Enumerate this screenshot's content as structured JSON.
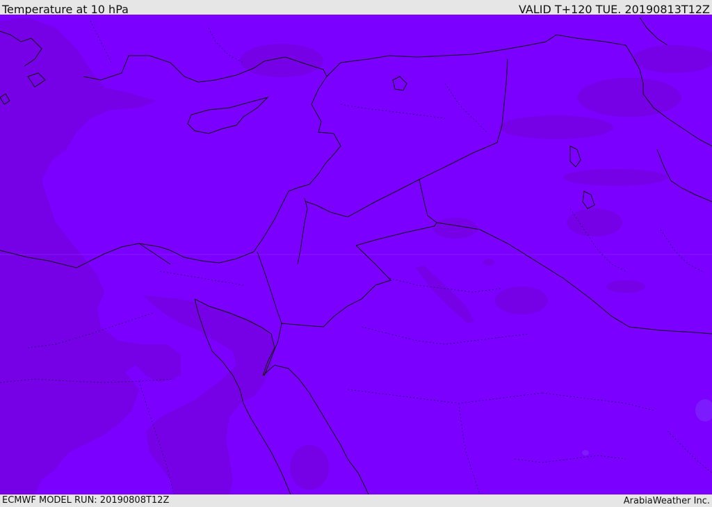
{
  "header": {
    "title": "Temperature at 10 hPa",
    "valid": "VALID T+120 TUE. 20190813T12Z"
  },
  "footer": {
    "model_run": "ECMWF MODEL RUN: 20190808T12Z",
    "brand": "ArabiaWeather Inc."
  },
  "colors": {
    "field_main": "#7b00ff",
    "field_dark": "#7600e6",
    "field_light": "#7d1bff",
    "border_line": "#111111",
    "province_line": "#2a0a6b",
    "bar_background": "#e6e6e6"
  }
}
